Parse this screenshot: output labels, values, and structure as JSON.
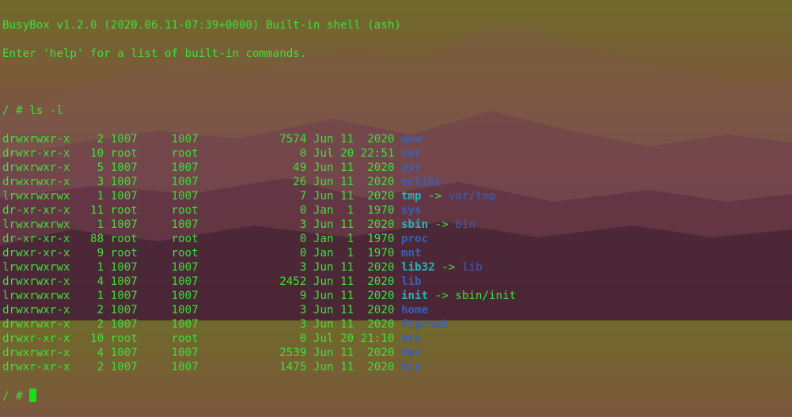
{
  "banner": {
    "line1": "BusyBox v1.2.0 (2020.06.11-07:39+0000) Built-in shell (ash)",
    "line2": "Enter 'help' for a list of built-in commands."
  },
  "prompt": "/ #",
  "command": "ls -l",
  "colors": {
    "text": "#3fe03a",
    "directory": "#3a5fb8",
    "symlink": "#2ab0b8",
    "cursor": "#18e018"
  },
  "listing": [
    {
      "perm": "drwxrwxr-x",
      "links": "2",
      "owner": "1007",
      "group": "1007",
      "size": "7574",
      "month": "Jun",
      "day": "11",
      "time": "2020",
      "name": "www",
      "kind": "dir",
      "target": ""
    },
    {
      "perm": "drwxr-xr-x",
      "links": "10",
      "owner": "root",
      "group": "root",
      "size": "0",
      "month": "Jul",
      "day": "20",
      "time": "22:51",
      "name": "var",
      "kind": "dir",
      "target": ""
    },
    {
      "perm": "drwxrwxr-x",
      "links": "5",
      "owner": "1007",
      "group": "1007",
      "size": "49",
      "month": "Jun",
      "day": "11",
      "time": "2020",
      "name": "usr",
      "kind": "dir",
      "target": ""
    },
    {
      "perm": "drwxrwxr-x",
      "links": "3",
      "owner": "1007",
      "group": "1007",
      "size": "26",
      "month": "Jun",
      "day": "11",
      "time": "2020",
      "name": "uclibc",
      "kind": "dir",
      "target": ""
    },
    {
      "perm": "lrwxrwxrwx",
      "links": "1",
      "owner": "1007",
      "group": "1007",
      "size": "7",
      "month": "Jun",
      "day": "11",
      "time": "2020",
      "name": "tmp",
      "kind": "link",
      "target": "var/tmp",
      "target_kind": "dir"
    },
    {
      "perm": "dr-xr-xr-x",
      "links": "11",
      "owner": "root",
      "group": "root",
      "size": "0",
      "month": "Jan",
      "day": "1",
      "time": "1970",
      "name": "sys",
      "kind": "dir",
      "target": ""
    },
    {
      "perm": "lrwxrwxrwx",
      "links": "1",
      "owner": "1007",
      "group": "1007",
      "size": "3",
      "month": "Jun",
      "day": "11",
      "time": "2020",
      "name": "sbin",
      "kind": "link",
      "target": "bin",
      "target_kind": "dir"
    },
    {
      "perm": "dr-xr-xr-x",
      "links": "88",
      "owner": "root",
      "group": "root",
      "size": "0",
      "month": "Jan",
      "day": "1",
      "time": "1970",
      "name": "proc",
      "kind": "dir",
      "target": ""
    },
    {
      "perm": "drwxr-xr-x",
      "links": "9",
      "owner": "root",
      "group": "root",
      "size": "0",
      "month": "Jan",
      "day": "1",
      "time": "1970",
      "name": "mnt",
      "kind": "dir",
      "target": ""
    },
    {
      "perm": "lrwxrwxrwx",
      "links": "1",
      "owner": "1007",
      "group": "1007",
      "size": "3",
      "month": "Jun",
      "day": "11",
      "time": "2020",
      "name": "lib32",
      "kind": "link",
      "target": "lib",
      "target_kind": "dir"
    },
    {
      "perm": "drwxrwxr-x",
      "links": "4",
      "owner": "1007",
      "group": "1007",
      "size": "2452",
      "month": "Jun",
      "day": "11",
      "time": "2020",
      "name": "lib",
      "kind": "dir",
      "target": ""
    },
    {
      "perm": "lrwxrwxrwx",
      "links": "1",
      "owner": "1007",
      "group": "1007",
      "size": "9",
      "month": "Jun",
      "day": "11",
      "time": "2020",
      "name": "init",
      "kind": "link",
      "target": "sbin/init",
      "target_kind": "file"
    },
    {
      "perm": "drwxrwxr-x",
      "links": "2",
      "owner": "1007",
      "group": "1007",
      "size": "3",
      "month": "Jun",
      "day": "11",
      "time": "2020",
      "name": "home",
      "kind": "dir",
      "target": ""
    },
    {
      "perm": "drwxrwxr-x",
      "links": "2",
      "owner": "1007",
      "group": "1007",
      "size": "3",
      "month": "Jun",
      "day": "11",
      "time": "2020",
      "name": "ftproot",
      "kind": "dir",
      "target": ""
    },
    {
      "perm": "drwxr-xr-x",
      "links": "10",
      "owner": "root",
      "group": "root",
      "size": "0",
      "month": "Jul",
      "day": "20",
      "time": "21:10",
      "name": "etc",
      "kind": "dir",
      "target": ""
    },
    {
      "perm": "drwxrwxr-x",
      "links": "4",
      "owner": "1007",
      "group": "1007",
      "size": "2539",
      "month": "Jun",
      "day": "11",
      "time": "2020",
      "name": "dev",
      "kind": "dir",
      "target": ""
    },
    {
      "perm": "drwxr-xr-x",
      "links": "2",
      "owner": "1007",
      "group": "1007",
      "size": "1475",
      "month": "Jun",
      "day": "11",
      "time": "2020",
      "name": "bin",
      "kind": "dir",
      "target": ""
    }
  ]
}
